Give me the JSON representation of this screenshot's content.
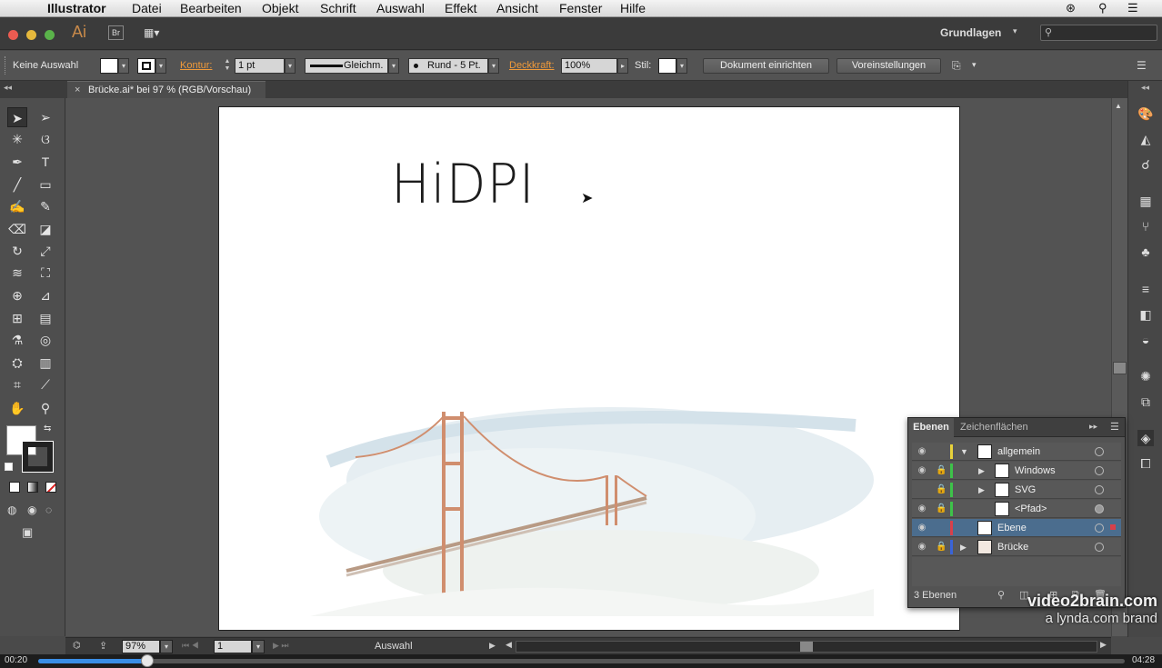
{
  "menubar": {
    "app": "Illustrator",
    "items": [
      "Datei",
      "Bearbeiten",
      "Objekt",
      "Schrift",
      "Auswahl",
      "Effekt",
      "Ansicht",
      "Fenster",
      "Hilfe"
    ]
  },
  "appbar": {
    "logo": "Ai",
    "bridge": "Br",
    "workspace": "Grundlagen",
    "search_placeholder": ""
  },
  "control": {
    "selection": "Keine Auswahl",
    "kontur_label": "Kontur:",
    "stroke_weight": "1 pt",
    "stroke_profile": "Gleichm.",
    "brush": "Rund - 5 Pt.",
    "opacity_label": "Deckkraft:",
    "opacity": "100%",
    "style_label": "Stil:",
    "doc_setup": "Dokument einrichten",
    "preferences": "Voreinstellungen"
  },
  "document": {
    "tab": "Brücke.ai* bei 97 % (RGB/Vorschau)"
  },
  "artboard": {
    "heading": "HiDPI"
  },
  "status": {
    "zoom": "97%",
    "artboard_number": "1",
    "tool": "Auswahl"
  },
  "layers_panel": {
    "tab_layers": "Ebenen",
    "tab_artboards": "Zeichenflächen",
    "rows": [
      {
        "name": "allgemein",
        "color": "#e8d23a"
      },
      {
        "name": "Windows",
        "color": "#3ec24a"
      },
      {
        "name": "SVG",
        "color": "#3ec24a"
      },
      {
        "name": "<Pfad>",
        "color": "#3ec24a"
      },
      {
        "name": "Ebene",
        "color": "#d8404a"
      },
      {
        "name": "Brücke",
        "color": "#3a64d8"
      }
    ],
    "count": "3 Ebenen"
  },
  "watermark": {
    "brand": "video2brain.com",
    "sub": "a lynda.com brand"
  },
  "timeline": {
    "current": "00:20",
    "total": "04:28",
    "progress": 0.1
  }
}
